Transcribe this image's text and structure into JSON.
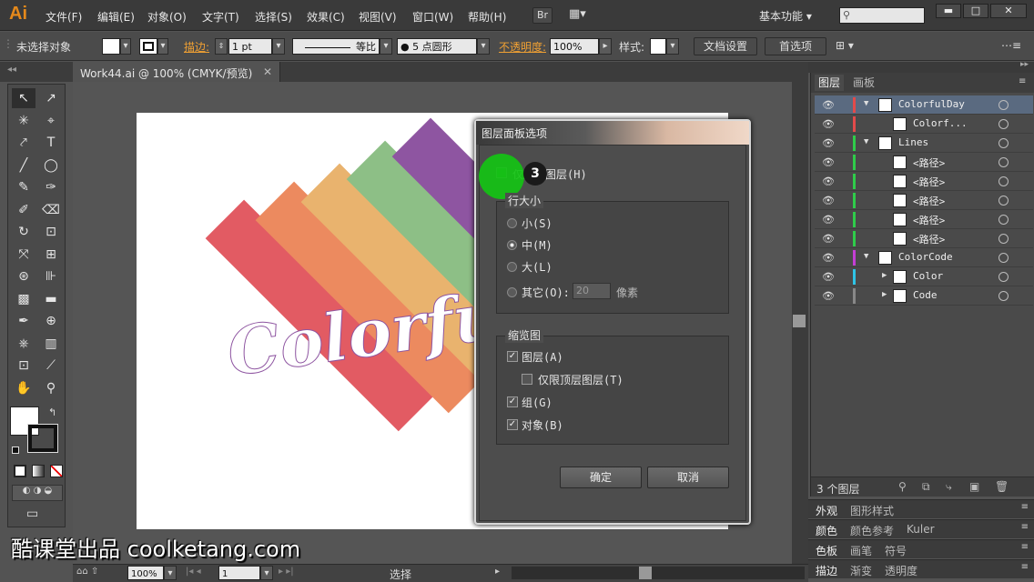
{
  "app": {
    "logo": "Ai",
    "workspace": "基本功能",
    "br": "Br"
  },
  "menu": [
    "文件(F)",
    "编辑(E)",
    "对象(O)",
    "文字(T)",
    "选择(S)",
    "效果(C)",
    "视图(V)",
    "窗口(W)",
    "帮助(H)"
  ],
  "options": {
    "selection": "未选择对象",
    "stroke_label": "描边:",
    "stroke_value": "1 pt",
    "profile": "等比",
    "brush": "5 点圆形",
    "opacity_label": "不透明度:",
    "opacity_value": "100%",
    "style_label": "样式:",
    "doc_setup": "文档设置",
    "prefs": "首选项"
  },
  "document": {
    "tab": "Work44.ai @ 100% (CMYK/预览)"
  },
  "artwork": {
    "text": "Colorful",
    "stripe_colors": [
      "#e25b63",
      "#ec8a5f",
      "#e9b36e",
      "#8dbf86",
      "#8e55a1"
    ]
  },
  "layers_panel": {
    "tabs": [
      "图层",
      "画板"
    ],
    "rows": [
      {
        "name": "ColorfulDay",
        "indent": 0,
        "expanded": true,
        "color": "#e24b4b",
        "selected": true
      },
      {
        "name": "Colorf...",
        "indent": 1,
        "expanded": null,
        "color": "#e24b4b",
        "selected": false
      },
      {
        "name": "Lines",
        "indent": 0,
        "expanded": true,
        "color": "#2fcc4a",
        "selected": false
      },
      {
        "name": "<路径>",
        "indent": 1,
        "expanded": null,
        "color": "#2fcc4a",
        "selected": false
      },
      {
        "name": "<路径>",
        "indent": 1,
        "expanded": null,
        "color": "#2fcc4a",
        "selected": false
      },
      {
        "name": "<路径>",
        "indent": 1,
        "expanded": null,
        "color": "#2fcc4a",
        "selected": false
      },
      {
        "name": "<路径>",
        "indent": 1,
        "expanded": null,
        "color": "#2fcc4a",
        "selected": false
      },
      {
        "name": "<路径>",
        "indent": 1,
        "expanded": null,
        "color": "#2fcc4a",
        "selected": false
      },
      {
        "name": "ColorCode",
        "indent": 0,
        "expanded": true,
        "color": "#c43fd4",
        "selected": false
      },
      {
        "name": "Color",
        "indent": 1,
        "expanded": false,
        "color": "#2fc4e6",
        "selected": false
      },
      {
        "name": "Code",
        "indent": 1,
        "expanded": false,
        "color": "#888888",
        "selected": false
      }
    ],
    "count": "3 个图层"
  },
  "collapsed_panels": [
    {
      "tabs": [
        "外观",
        "图形样式"
      ]
    },
    {
      "tabs": [
        "颜色",
        "颜色参考",
        "Kuler"
      ]
    },
    {
      "tabs": [
        "色板",
        "画笔",
        "符号"
      ]
    },
    {
      "tabs": [
        "描边",
        "渐变",
        "透明度"
      ]
    }
  ],
  "dialog": {
    "title": "图层面板选项",
    "show_layers_only": "仅显示图层(H)",
    "step": "3",
    "row_size_title": "行大小",
    "row_small": "小(S)",
    "row_medium": "中(M)",
    "row_large": "大(L)",
    "row_other": "其它(O):",
    "row_other_value": "20",
    "row_other_unit": "像素",
    "thumb_title": "缩览图",
    "thumb_layers": "图层(A)",
    "thumb_top_only": "仅限顶层图层(T)",
    "thumb_group": "组(G)",
    "thumb_object": "对象(B)",
    "ok": "确定",
    "cancel": "取消"
  },
  "status": {
    "zoom": "100%",
    "page": "1",
    "tool": "选择"
  },
  "watermark": "酷课堂出品 coolketang.com"
}
